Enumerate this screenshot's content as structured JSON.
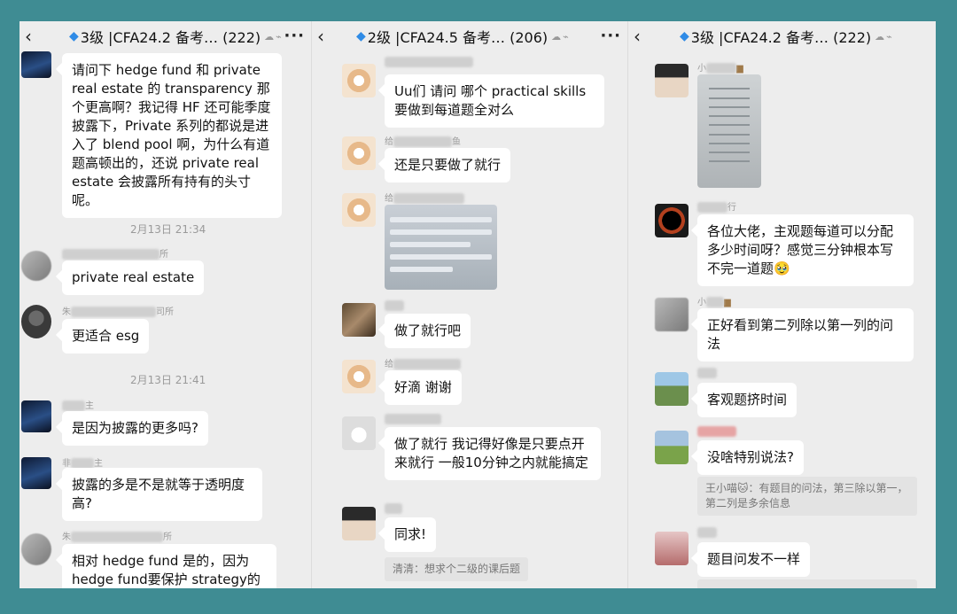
{
  "panes": [
    {
      "header": {
        "back_icon": "chevron-left-icon",
        "title": "3级 |CFA24.2 备考… (222)",
        "diamond_icon": "diamond-icon",
        "status_icons": "mute-and-cloud-icons",
        "more_icon": "more-icon"
      },
      "messages": [
        {
          "text": "请问下 hedge fund 和 private real estate 的 transparency 那个更高啊？我记得 HF 还可能季度披露下，Private 系列的都说是进入了 blend pool 啊，为什么有道题高顿出的，还说 private real estate 会披露所有持有的头寸呢。"
        },
        {
          "time": "2月13日 21:34"
        },
        {
          "nick_suffix": "所",
          "text": "private real estate"
        },
        {
          "nick_prefix": "朱",
          "nick_suffix": "司所",
          "text": "更适合 esg"
        },
        {
          "time": "2月13日 21:41"
        },
        {
          "nick_suffix": "主",
          "text": "是因为披露的更多吗?"
        },
        {
          "nick_prefix": "非",
          "nick_suffix": "主",
          "text": "披露的多是不是就等于透明度高?"
        },
        {
          "nick_prefix": "朱",
          "nick_suffix": "所",
          "text": "相对 hedge fund 是的，因为 hedge fund要保护 strategy的有"
        }
      ]
    },
    {
      "header": {
        "back_icon": "chevron-left-icon",
        "title": "2级 |CFA24.5 备考… (206)",
        "diamond_icon": "diamond-icon",
        "status_icons": "mute-and-cloud-icons",
        "more_icon": "more-icon"
      },
      "messages": [
        {
          "text": "Uu们 请问 哪个 practical skills 要做到每道题全对么"
        },
        {
          "nick_prefix": "给",
          "nick_suffix": "鱼",
          "text": "还是只要做了就行"
        },
        {
          "nick_prefix": "给",
          "image": "screenshot-image"
        },
        {
          "text": "做了就行吧"
        },
        {
          "nick_prefix": "给",
          "text": "好滴 谢谢"
        },
        {
          "text": "做了就行 我记得好像是只要点开来就行 一般10分钟之内就能搞定"
        },
        {
          "text": "同求!",
          "quote": "清清：想求个二级的课后题"
        }
      ]
    },
    {
      "header": {
        "back_icon": "chevron-left-icon",
        "title": "3级 |CFA24.2 备考… (222)",
        "diamond_icon": "diamond-icon",
        "status_icons": "mute-and-cloud-icons",
        "more_icon": "more-icon"
      },
      "messages": [
        {
          "nick_prefix": "小",
          "image": "document-photo"
        },
        {
          "nick_prefix": "行",
          "text": "各位大佬，主观题每道可以分配多少时间呀？感觉三分钟根本写不完一道题🥹"
        },
        {
          "nick_prefix": "小",
          "text": "正好看到第二列除以第一列的问法"
        },
        {
          "text": "客观题挤时间"
        },
        {
          "text": "没啥特别说法?",
          "quote": "王小喵🐱：有题目的问法，第三除以第一，第二列是多余信息"
        },
        {
          "text": "题目问发不一样"
        }
      ]
    }
  ]
}
